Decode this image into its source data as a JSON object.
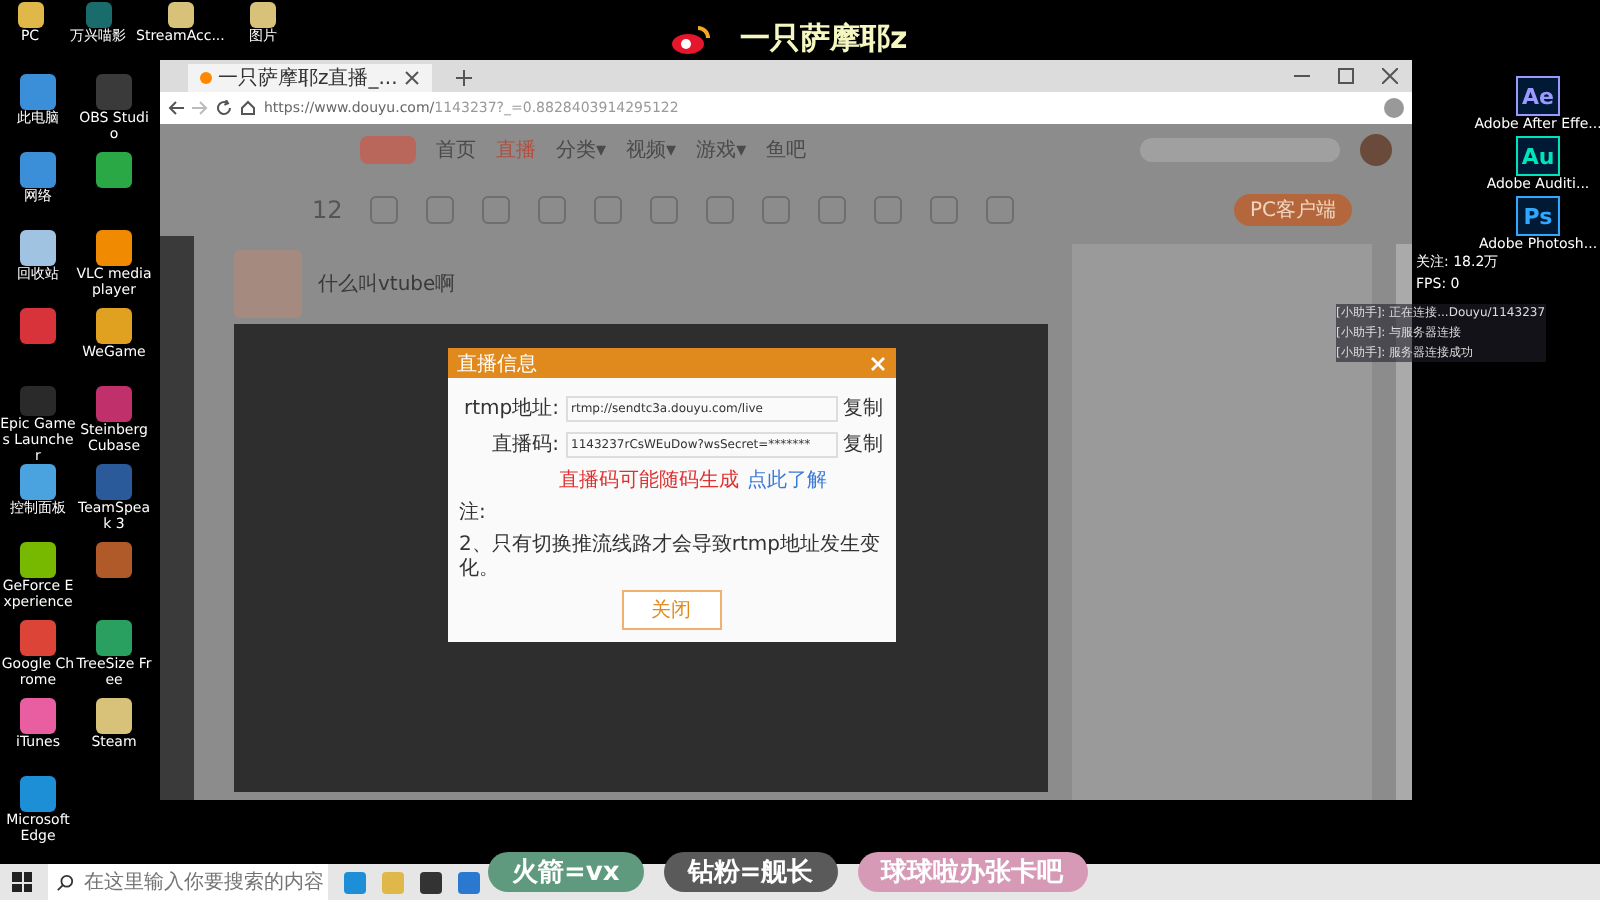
{
  "overlay_title": "一只萨摩耶z",
  "top_icons": [
    {
      "label": "PC",
      "color": "#e0b84a"
    },
    {
      "label": "万兴喵影",
      "color": "#1a6b6b"
    },
    {
      "label": "StreamAcc...",
      "color": "#d8c27a"
    },
    {
      "label": "图片",
      "color": "#d8c27a"
    }
  ],
  "left_icons": [
    {
      "label": "此电脑",
      "color": "#3a8fd8"
    },
    {
      "label": "OBS Studio",
      "color": "#3a3a3a"
    },
    {
      "label": "网络",
      "color": "#3a8fd8"
    },
    {
      "color": "#2aa845"
    },
    {
      "label": "回收站",
      "color": "#9fc3e0"
    },
    {
      "label": "VLC media player",
      "color": "#f08a00"
    },
    {
      "color": "#d8333a"
    },
    {
      "label": "WeGame",
      "color": "#e0a020"
    },
    {
      "label": "Epic Games Launcher",
      "color": "#2a2a2a"
    },
    {
      "label": "Steinberg Cubase",
      "color": "#c0306a"
    },
    {
      "label": "控制面板",
      "color": "#4aa3df"
    },
    {
      "label": "TeamSpeak 3",
      "color": "#2a5a9a"
    },
    {
      "label": "GeForce Experience",
      "color": "#76b900"
    },
    {
      "color": "#b05a2a"
    },
    {
      "label": "Google Chrome",
      "color": "#db4437"
    },
    {
      "label": "TreeSize Free",
      "color": "#2aa060"
    },
    {
      "label": "iTunes",
      "color": "#e85ea0"
    },
    {
      "label": "Steam",
      "color": "#d8c27a"
    },
    {
      "label": "Microsoft Edge",
      "color": "#1c8fd6"
    }
  ],
  "right_icons": [
    {
      "glyph": "Ae",
      "label": "Adobe After Effe...",
      "color": "#9999ff"
    },
    {
      "glyph": "Au",
      "label": "Adobe Auditi...",
      "color": "#00e4bb"
    },
    {
      "glyph": "Ps",
      "label": "Adobe Photosh...",
      "color": "#31a8ff"
    }
  ],
  "browser": {
    "tab_title": "一只萨摩耶z直播_...",
    "url_host": "https://www.douyu.com/",
    "url_path": "1143237?_=0.8828403914295122",
    "nav": [
      {
        "label": "首页",
        "selected": false
      },
      {
        "label": "直播",
        "selected": true
      },
      {
        "label": "分类▾",
        "selected": false
      },
      {
        "label": "视频▾",
        "selected": false
      },
      {
        "label": "游戏▾",
        "selected": false
      },
      {
        "label": "鱼吧",
        "selected": false
      }
    ],
    "counter": "12",
    "client_button": "PC客户端",
    "room_title": "什么叫vtube啊"
  },
  "dialog": {
    "title": "直播信息",
    "fields": [
      {
        "label": "rtmp地址:",
        "value": "rtmp://sendtc3a.douyu.com/live",
        "action": "复制"
      },
      {
        "label": "直播码:",
        "value": "1143237rCsWEuDow?wsSecret=*******",
        "action": "复制"
      }
    ],
    "warning": "直播码可能随码生成",
    "link": "点此了解",
    "note_title": "注:",
    "notes": [
      "2、只有切换推流线路才会导致rtmp地址发生变化。"
    ],
    "close": "关闭"
  },
  "stats": [
    "关注: 18.2万",
    "FPS: 0"
  ],
  "chat": [
    "[小助手]: 正在连接...Douyu/1143237",
    "[小助手]: 与服务器连接",
    "[小助手]: 服务器连接成功"
  ],
  "taskbar": {
    "search_placeholder": "在这里输入你要搜索的内容"
  },
  "banners": [
    {
      "text": "火箭=vx",
      "color": "#5f9a7e"
    },
    {
      "text": "钻粉=舰长",
      "color": "#5a5a5a"
    },
    {
      "text": "球球啦办张卡吧",
      "color": "#d69ab6"
    }
  ]
}
